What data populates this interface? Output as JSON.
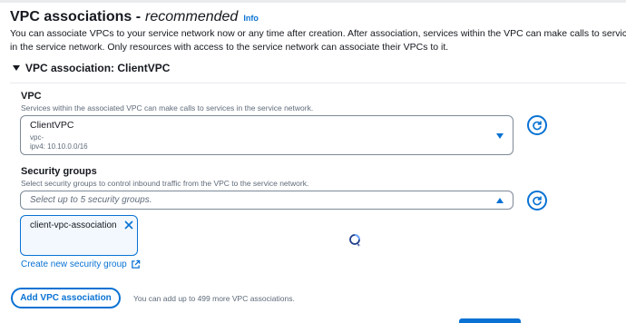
{
  "header": {
    "title": "VPC associations -",
    "title_emphasis": "recommended",
    "info_label": "Info",
    "description": "You can associate VPCs to your service network now or any time after creation. After association, services within the VPC can make calls to services in the service network. Only resources with access to the service network can associate their VPCs to it."
  },
  "association": {
    "section_title": "VPC association: ClientVPC",
    "vpc": {
      "label": "VPC",
      "description": "Services within the associated VPC can make calls to services in the service network.",
      "selected_name": "ClientVPC",
      "selected_id": "vpc-",
      "selected_cidr": "ipv4: 10.10.0.0/16"
    },
    "security_groups": {
      "label": "Security groups",
      "description": "Select security groups to control inbound traffic from the VPC to the service network.",
      "placeholder": "Select up to 5 security groups.",
      "tokens": [
        "client-vpc-association"
      ]
    },
    "create_sg_link": "Create new security group"
  },
  "footer": {
    "add_button": "Add VPC association",
    "hint": "You can add up to 499 more VPC associations."
  },
  "colors": {
    "accent": "#0972d3",
    "text": "#16191f",
    "muted": "#5f6b7a",
    "border": "#7d8998"
  },
  "icons": [
    "info-link",
    "caret-down-icon",
    "refresh-icon",
    "close-icon",
    "external-link-icon",
    "loading-cursor-icon"
  ]
}
